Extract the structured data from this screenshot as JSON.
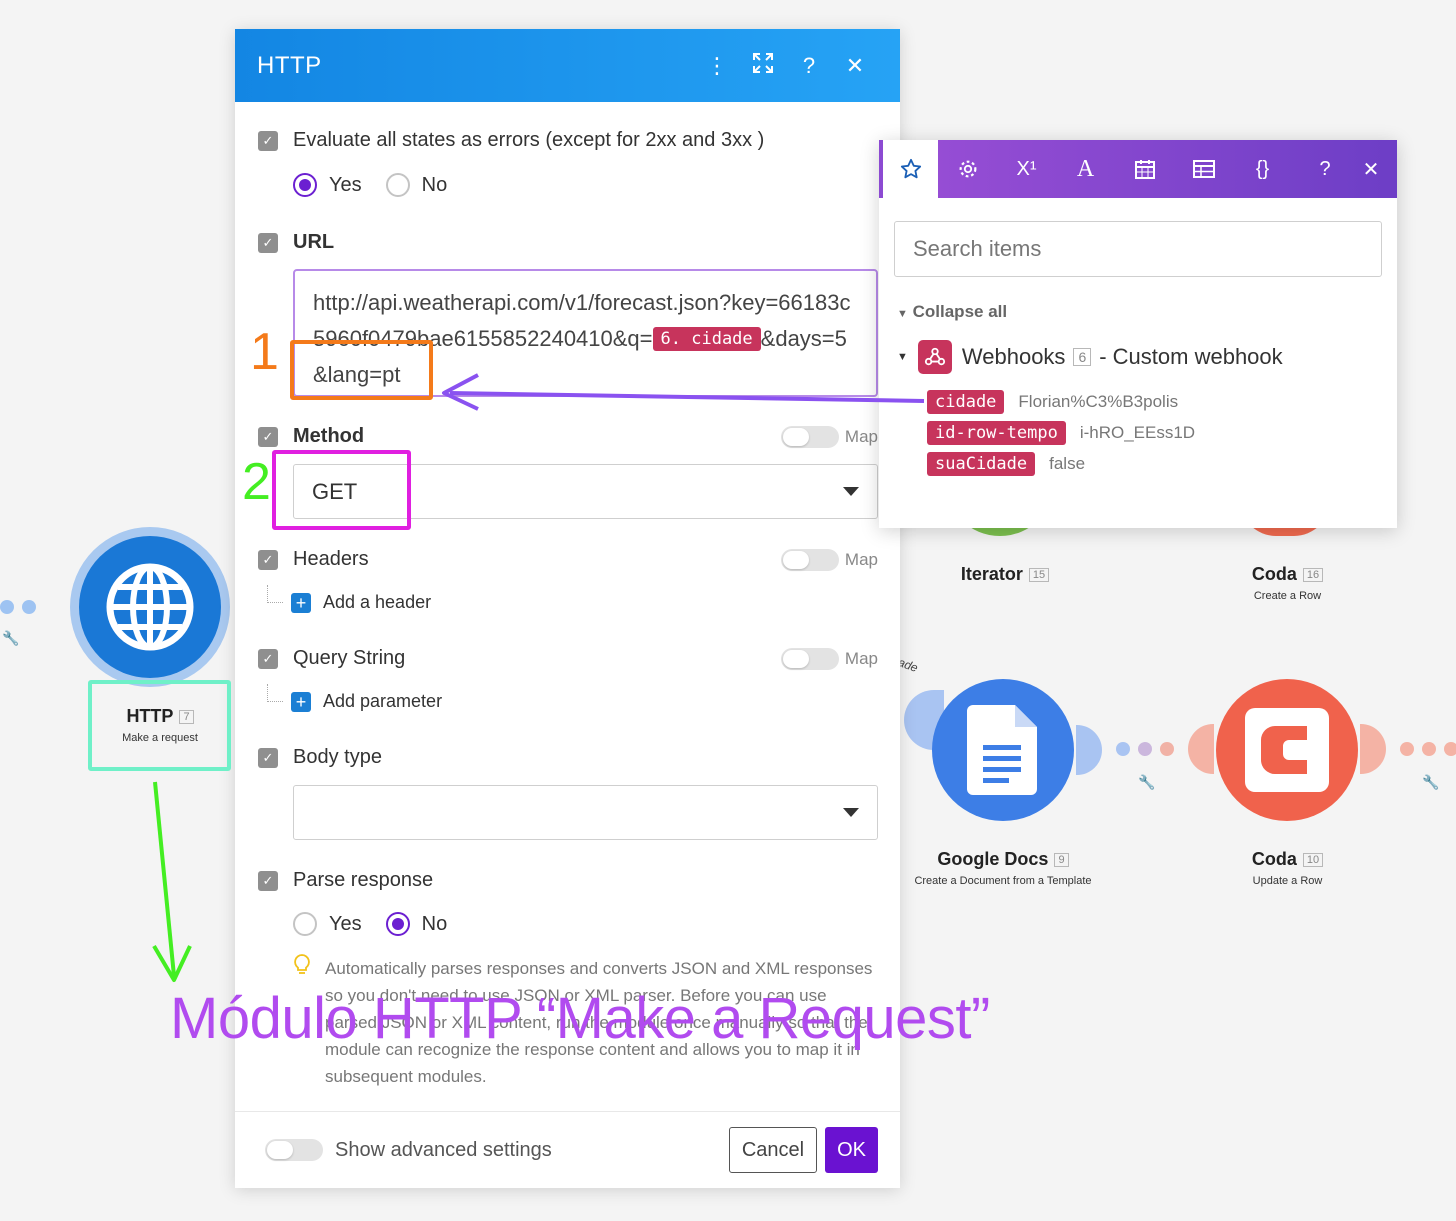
{
  "dialog": {
    "title": "HTTP",
    "evaluate": {
      "label": "Evaluate all states as errors (except for 2xx and 3xx )",
      "yes": "Yes",
      "no": "No",
      "selected": "Yes"
    },
    "url": {
      "label": "URL",
      "text_before": "http://api.weatherapi.com/v1/forecast.json?key=66183c5960f0479bae6155852240410&q=",
      "pill": "6. cidade",
      "text_after": "&days=5&lang=pt"
    },
    "method": {
      "label": "Method",
      "value": "GET",
      "map_label": "Map"
    },
    "headers": {
      "label": "Headers",
      "add_label": "Add a header",
      "map_label": "Map"
    },
    "query_string": {
      "label": "Query String",
      "add_label": "Add parameter",
      "map_label": "Map"
    },
    "body_type": {
      "label": "Body type",
      "value": ""
    },
    "parse_response": {
      "label": "Parse response",
      "yes": "Yes",
      "no": "No",
      "selected": "No",
      "hint": "Automatically parses responses and converts JSON and XML responses so you don't need to use JSON or XML parser. Before you can use parsed JSON or XML content, run the module once manually so that the module can recognize the response content and allows you to map it in subsequent modules."
    },
    "footer": {
      "advanced_label": "Show advanced settings",
      "cancel": "Cancel",
      "ok": "OK"
    }
  },
  "panel": {
    "tabs": [
      "star-icon",
      "gear-icon",
      "superscript-icon",
      "text-icon",
      "calendar-icon",
      "table-icon",
      "braces-icon"
    ],
    "tab_glyphs": {
      "superscript": "X¹",
      "text": "A",
      "braces": "{}",
      "help": "?",
      "close": "✕"
    },
    "search_placeholder": "Search items",
    "collapse_label": "Collapse all",
    "webhook": {
      "name": "Webhooks",
      "id": "6",
      "suffix": "- Custom webhook"
    },
    "items": [
      {
        "key": "cidade",
        "value": "Florian%C3%B3polis"
      },
      {
        "key": "id-row-tempo",
        "value": "i-hRO_EEss1D"
      },
      {
        "key": "suaCidade",
        "value": "false"
      }
    ]
  },
  "canvas": {
    "modules": [
      {
        "title": "HTTP",
        "id": "7",
        "subtitle": "Make a request"
      },
      {
        "title": "Iterator",
        "id": "15",
        "subtitle": ""
      },
      {
        "title": "Coda",
        "id": "16",
        "subtitle": "Create a Row"
      },
      {
        "title": "Google Docs",
        "id": "9",
        "subtitle": "Create a Document from a Template"
      },
      {
        "title": "Coda",
        "id": "10",
        "subtitle": "Update a Row"
      }
    ],
    "edge_label": "ade"
  },
  "annotations": {
    "num1": "1",
    "num2": "2",
    "caption": "Módulo HTTP “Make a Request”"
  },
  "colors": {
    "dialog_header": "#1a8ff0",
    "accent_purple": "#6a12d1",
    "pill": "#c7345c",
    "annotation_orange": "#f47a1a",
    "annotation_magenta": "#e01fe0",
    "annotation_green": "#44ee22",
    "annotation_cyan": "#6ff0c8",
    "arrow_purple": "#8a52f0",
    "caption_purple": "#b14bef"
  }
}
